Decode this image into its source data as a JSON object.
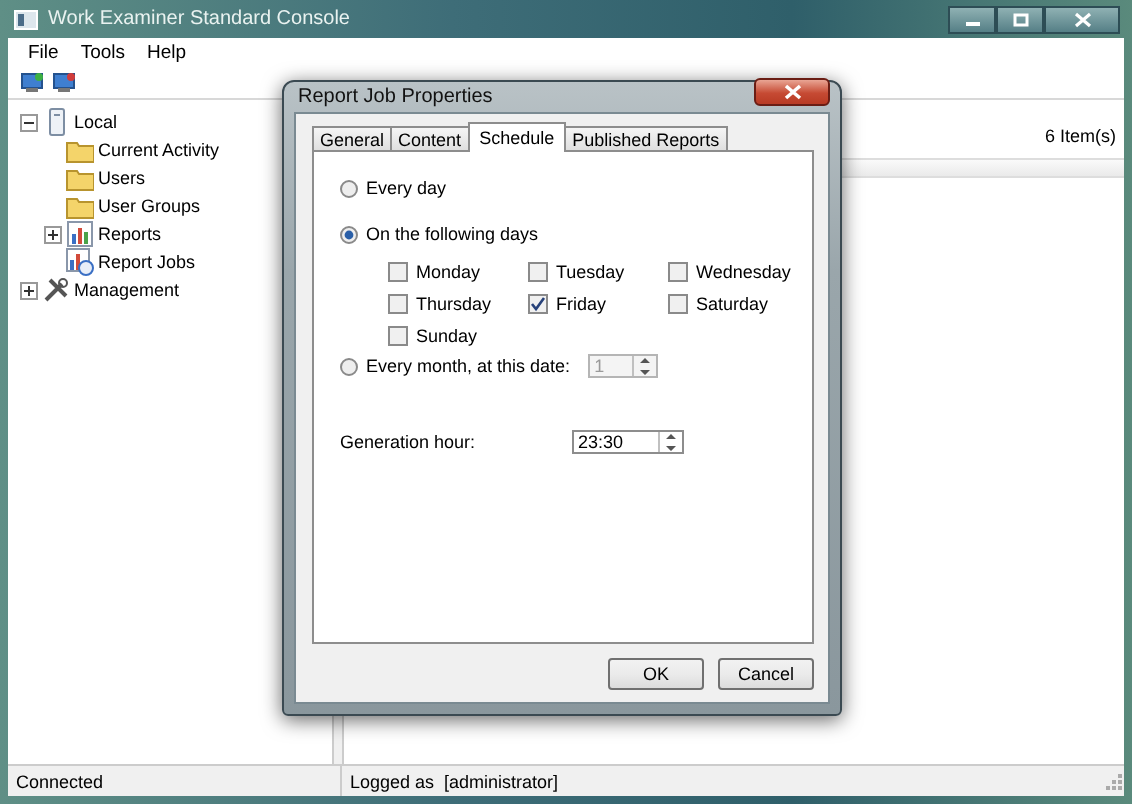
{
  "window": {
    "title": "Work Examiner Standard Console"
  },
  "menu": [
    "File",
    "Tools",
    "Help"
  ],
  "tree": [
    {
      "label": "Local",
      "kind": "computer",
      "expanded": true,
      "children": [
        {
          "label": "Current Activity",
          "kind": "folder"
        },
        {
          "label": "Users",
          "kind": "folder"
        },
        {
          "label": "User Groups",
          "kind": "folder"
        },
        {
          "label": "Reports",
          "kind": "reports",
          "expanded": false
        },
        {
          "label": "Report Jobs",
          "kind": "jobs"
        }
      ]
    },
    {
      "label": "Management",
      "kind": "tools",
      "expanded": false
    }
  ],
  "list": {
    "item_count": "6 Item(s)"
  },
  "status_bar": {
    "connection": "Connected",
    "user": "Logged as  [administrator]"
  },
  "dialog": {
    "title": "Report Job Properties",
    "tabs": [
      {
        "label": "General",
        "selected": false
      },
      {
        "label": "Content",
        "selected": false
      },
      {
        "label": "Schedule",
        "selected": true
      },
      {
        "label": "Published Reports",
        "selected": false
      }
    ],
    "options": [
      {
        "label": "Every day",
        "selected": false
      },
      {
        "label": "On the following days",
        "selected": true
      },
      {
        "label": "Every month, at this date:",
        "selected": false
      }
    ],
    "days": [
      {
        "label": "Monday",
        "checked": false
      },
      {
        "label": "Tuesday",
        "checked": false
      },
      {
        "label": "Wednesday",
        "checked": false
      },
      {
        "label": "Thursday",
        "checked": false
      },
      {
        "label": "Friday",
        "checked": true
      },
      {
        "label": "Saturday",
        "checked": false
      },
      {
        "label": "Sunday",
        "checked": false
      }
    ],
    "month_date": {
      "value": "1",
      "disabled": true
    },
    "generation_hour": {
      "label": "Generation hour:",
      "value": "23:30"
    },
    "buttons": [
      "OK",
      "Cancel"
    ]
  }
}
